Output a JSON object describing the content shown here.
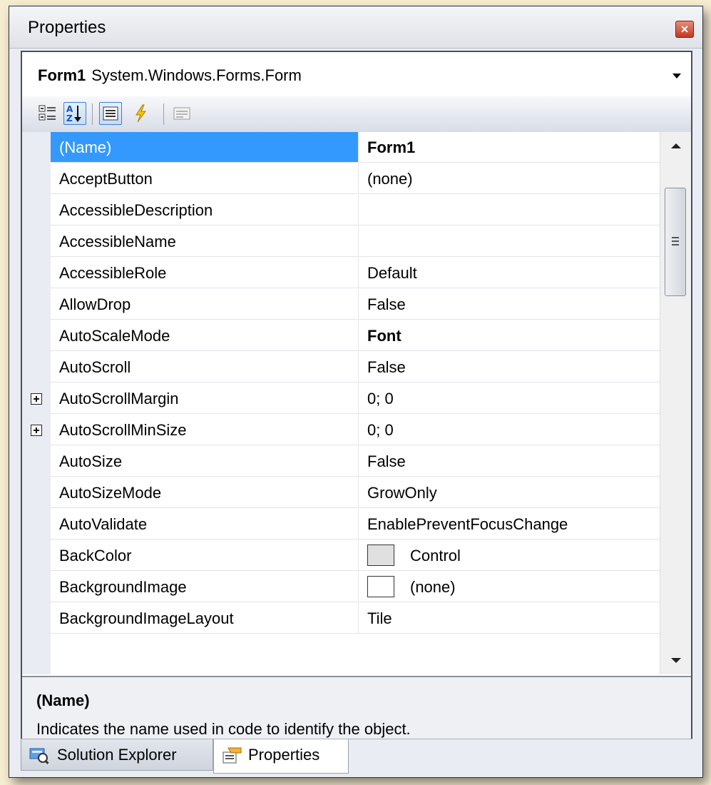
{
  "window": {
    "title": "Properties"
  },
  "object_selector": {
    "name": "Form1",
    "type": "System.Windows.Forms.Form"
  },
  "toolbar": {
    "buttons": [
      "categorized-icon",
      "alphabetical-icon",
      "properties-icon",
      "events-icon",
      "property-pages-icon"
    ]
  },
  "properties": [
    {
      "name": "(Name)",
      "value": "Form1"
    },
    {
      "name": "AcceptButton",
      "value": "(none)"
    },
    {
      "name": "AccessibleDescription",
      "value": ""
    },
    {
      "name": "AccessibleName",
      "value": ""
    },
    {
      "name": "AccessibleRole",
      "value": "Default"
    },
    {
      "name": "AllowDrop",
      "value": "False"
    },
    {
      "name": "AutoScaleMode",
      "value": "Font"
    },
    {
      "name": "AutoScroll",
      "value": "False"
    },
    {
      "name": "AutoScrollMargin",
      "value": "0; 0"
    },
    {
      "name": "AutoScrollMinSize",
      "value": "0; 0"
    },
    {
      "name": "AutoSize",
      "value": "False"
    },
    {
      "name": "AutoSizeMode",
      "value": "GrowOnly"
    },
    {
      "name": "AutoValidate",
      "value": "EnablePreventFocusChange"
    },
    {
      "name": "BackColor",
      "value": "Control"
    },
    {
      "name": "BackgroundImage",
      "value": "(none)"
    },
    {
      "name": "BackgroundImageLayout",
      "value": "Tile"
    }
  ],
  "colors": {
    "selection": "#3399ff",
    "back_color_swatch": "#e0e0e0",
    "background_image_swatch": "#ffffff"
  },
  "description": {
    "title": "(Name)",
    "text": "Indicates the name used in code to identify the object."
  },
  "tabs": [
    {
      "label": "Solution Explorer",
      "icon": "solution-explorer-icon"
    },
    {
      "label": "Properties",
      "icon": "properties-tab-icon"
    }
  ]
}
